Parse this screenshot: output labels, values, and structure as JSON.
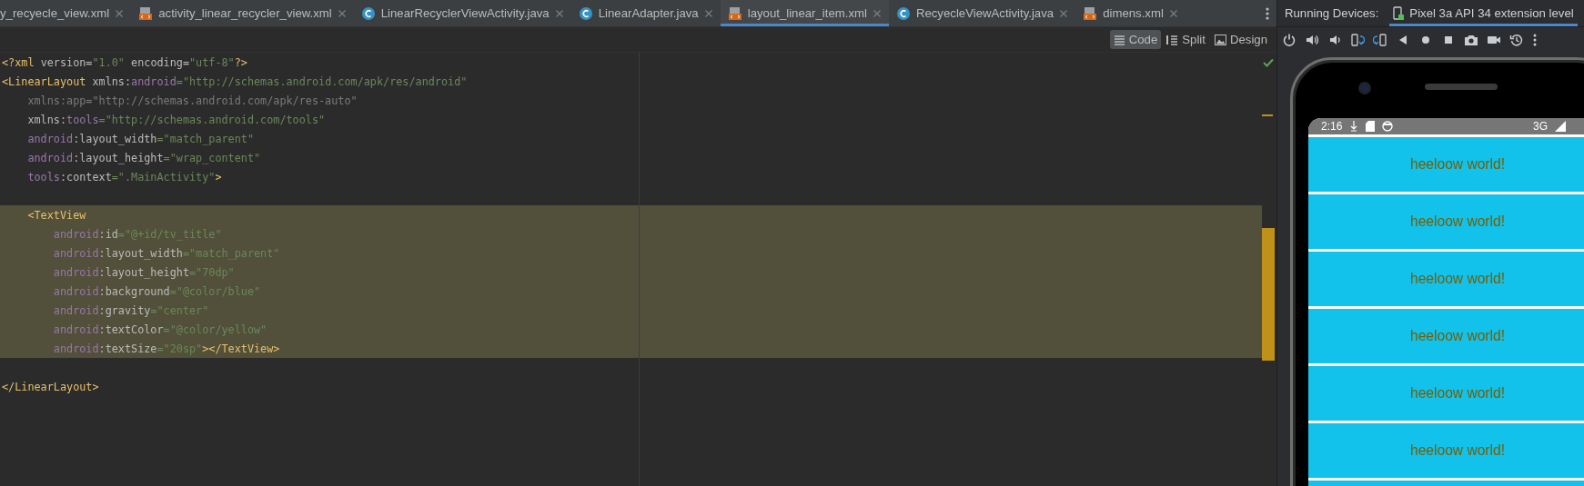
{
  "editor_tabs": [
    {
      "kind": "plain",
      "label": "y_recyecle_view.xml",
      "selected": false
    },
    {
      "kind": "xml",
      "label": "activity_linear_recycler_view.xml",
      "selected": false
    },
    {
      "kind": "java",
      "label": "LinearRecyclerViewActivity.java",
      "selected": false
    },
    {
      "kind": "java",
      "label": "LinearAdapter.java",
      "selected": false
    },
    {
      "kind": "xml",
      "label": "layout_linear_item.xml",
      "selected": true
    },
    {
      "kind": "java",
      "label": "RecyecleViewActivity.java",
      "selected": false
    },
    {
      "kind": "xml",
      "label": "dimens.xml",
      "selected": false
    }
  ],
  "view_modes": [
    {
      "kind": "code",
      "label": "Code",
      "selected": true
    },
    {
      "kind": "split",
      "label": "Split",
      "selected": false
    },
    {
      "kind": "design",
      "label": "Design",
      "selected": false
    }
  ],
  "code_lines": [
    {
      "selected": false,
      "tokens": [
        {
          "kind": "tag",
          "text": "<?xml "
        },
        {
          "kind": "plain",
          "text": "version="
        },
        {
          "kind": "string",
          "text": "\"1.0\""
        },
        {
          "kind": "plain",
          "text": " encoding="
        },
        {
          "kind": "string",
          "text": "\"utf-8\""
        },
        {
          "kind": "tag",
          "text": "?>"
        }
      ]
    },
    {
      "selected": false,
      "tokens": [
        {
          "kind": "tag",
          "text": "<LinearLayout "
        },
        {
          "kind": "plain",
          "text": "xmlns:"
        },
        {
          "kind": "ns",
          "text": "android"
        },
        {
          "kind": "string",
          "text": "=\"http://schemas.android.com/apk/res/android\""
        }
      ]
    },
    {
      "selected": false,
      "tokens": [
        {
          "kind": "unused",
          "text": "    xmlns:app=\"http://schemas.android.com/apk/res-auto\""
        }
      ]
    },
    {
      "selected": false,
      "tokens": [
        {
          "kind": "plain",
          "text": "    xmlns:"
        },
        {
          "kind": "ns",
          "text": "tools"
        },
        {
          "kind": "string",
          "text": "=\"http://schemas.android.com/tools\""
        }
      ]
    },
    {
      "selected": false,
      "tokens": [
        {
          "kind": "ns",
          "text": "    android"
        },
        {
          "kind": "plain",
          "text": ":layout_width"
        },
        {
          "kind": "string",
          "text": "=\"match_parent\""
        }
      ]
    },
    {
      "selected": false,
      "tokens": [
        {
          "kind": "ns",
          "text": "    android"
        },
        {
          "kind": "plain",
          "text": ":layout_height"
        },
        {
          "kind": "string",
          "text": "=\"wrap_content\""
        }
      ]
    },
    {
      "selected": false,
      "tokens": [
        {
          "kind": "ns",
          "text": "    tools"
        },
        {
          "kind": "plain",
          "text": ":context"
        },
        {
          "kind": "string",
          "text": "=\".MainActivity\""
        },
        {
          "kind": "tag",
          "text": ">"
        }
      ]
    },
    {
      "selected": false
    },
    {
      "selected": true,
      "tokens": [
        {
          "kind": "tag",
          "text": "    <TextView"
        }
      ]
    },
    {
      "selected": true,
      "tokens": [
        {
          "kind": "ns",
          "text": "        android"
        },
        {
          "kind": "plain",
          "text": ":id"
        },
        {
          "kind": "string",
          "text": "=\"@+id/tv_title\""
        }
      ]
    },
    {
      "selected": true,
      "tokens": [
        {
          "kind": "ns",
          "text": "        android"
        },
        {
          "kind": "plain",
          "text": ":layout_width"
        },
        {
          "kind": "string",
          "text": "=\"match_parent\""
        }
      ]
    },
    {
      "selected": true,
      "tokens": [
        {
          "kind": "ns",
          "text": "        android"
        },
        {
          "kind": "plain",
          "text": ":layout_height"
        },
        {
          "kind": "string",
          "text": "=\"70dp\""
        }
      ]
    },
    {
      "selected": true,
      "tokens": [
        {
          "kind": "ns",
          "text": "        android"
        },
        {
          "kind": "plain",
          "text": ":background"
        },
        {
          "kind": "string",
          "text": "=\"@color/blue\""
        }
      ]
    },
    {
      "selected": true,
      "tokens": [
        {
          "kind": "ns",
          "text": "        android"
        },
        {
          "kind": "plain",
          "text": ":gravity"
        },
        {
          "kind": "string",
          "text": "=\"center\""
        }
      ]
    },
    {
      "selected": true,
      "tokens": [
        {
          "kind": "ns",
          "text": "        android"
        },
        {
          "kind": "plain",
          "text": ":textColor"
        },
        {
          "kind": "string",
          "text": "=\"@color/yellow\""
        }
      ]
    },
    {
      "selected": true,
      "tokens": [
        {
          "kind": "ns",
          "text": "        android"
        },
        {
          "kind": "plain",
          "text": ":textSize"
        },
        {
          "kind": "string",
          "text": "=\"20sp\""
        },
        {
          "kind": "tag",
          "text": "></TextView>"
        }
      ]
    },
    {
      "selected": false
    },
    {
      "selected": false,
      "tokens": [
        {
          "kind": "tag",
          "text": "</LinearLayout>"
        }
      ]
    }
  ],
  "running_devices": {
    "label": "Running Devices:",
    "device_tab": "Pixel 3a API 34 extension level",
    "status_bar": {
      "time": "2:16",
      "network": "3G"
    },
    "list_items": [
      "heeloow world!",
      "heeloow world!",
      "heeloow world!",
      "heeloow world!",
      "heeloow world!",
      "heeloow world!"
    ]
  }
}
